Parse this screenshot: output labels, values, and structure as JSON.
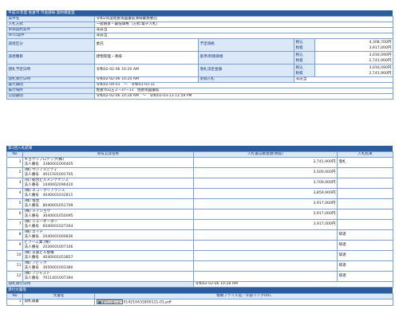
{
  "header1": {
    "title": "平成31年度 佐倉市 市長部局 契約検査室"
  },
  "info": {
    "case_name": {
      "label": "案件名",
      "value": "令和2年度佐倉南図書館清掃業務委託"
    },
    "bid_method": {
      "label": "入札方式",
      "value": "一般競争・最低価格（方式:電子入札）"
    },
    "related_case": {
      "label": "単価契約案件",
      "value": "非該当"
    },
    "wto": {
      "label": "WTO案件",
      "value": "非該当"
    },
    "procurement_type": {
      "label": "調達区分",
      "value": "委託"
    },
    "category": {
      "label": "調達種目",
      "value": "建物管理・清掃"
    },
    "planned_price": {
      "label": "予定価格",
      "tax_incl_label": "税込",
      "tax_incl": "4,308,700円",
      "tax_excl_label": "税抜",
      "tax_excl": "3,917,000円"
    },
    "min_price": {
      "label": "基準/制限価格",
      "tax_incl_label": "税込",
      "tax_incl": "3,016,090円",
      "tax_excl_label": "税抜",
      "tax_excl": "2,741,900円"
    },
    "open_scheduled": {
      "label": "開札予定日時",
      "value": "令和02-02-06 10:20 AM"
    },
    "award_amount": {
      "label": "落札決定金額",
      "tax_incl_label": "税込",
      "tax_incl": "3,016,090円",
      "tax_excl_label": "税抜",
      "tax_excl": "2,741,900円"
    },
    "open_executed": {
      "label": "開札執行日時",
      "value": "令和02-02-06 10:20 AM"
    },
    "single_bid": {
      "label": "単価入札",
      "value": "非該当"
    },
    "period": {
      "label": "履行期間",
      "value": "令和02-04-01　～　令和03-03-31"
    },
    "location": {
      "label": "履行場所",
      "value": "佐倉市山王２−37−13　佐倉南図書館"
    },
    "public_period": {
      "label": "公開期間",
      "value": "令和02-02-06 10:28 AM　～　令和02-03-13 11:59 PM"
    }
  },
  "bids": {
    "title": "第1回入札結果",
    "col_no": "No",
    "col_name": "商号又は名称",
    "col_amount": "入札書記載金額(税抜)",
    "col_result": "入札結果",
    "rows": [
      {
        "no": "1",
        "company": "キョウワプロテック(株)",
        "reg": "法人番号　3380001000405",
        "amount": "2,741,900円",
        "result": "落札"
      },
      {
        "no": "2",
        "company": "(株) サンアメニティ",
        "reg": "法人番号　4011501001705",
        "amount": "3,500,000円",
        "result": ""
      },
      {
        "no": "3",
        "company": "(有) 総合ビルメンテナンス",
        "reg": "法人番号　1040002096420",
        "amount": "3,700,000円",
        "result": ""
      },
      {
        "no": "4",
        "company": "(株) エコ・クリアランス",
        "reg": "法人番号　4040001032811",
        "amount": "3,859,900円",
        "result": ""
      },
      {
        "no": "5",
        "company": "(株) 佐生",
        "reg": "法人番号　8040001051709",
        "amount": "3,917,000円",
        "result": ""
      },
      {
        "no": "6",
        "company": "(株) メイショウ",
        "reg": "法人番号　3040001050095",
        "amount": "3,917,000円",
        "result": ""
      },
      {
        "no": "7",
        "company": "(株) ニューオーダー",
        "reg": "法人番号　6040001027264",
        "amount": "3,917,000円",
        "result": ""
      },
      {
        "no": "8",
        "company": "(株) エイド",
        "reg": "法人番号　2040001000836",
        "amount": "",
        "result": "辞退"
      },
      {
        "no": "9",
        "company": "ビソー工業 (株)",
        "reg": "法人番号　2030001007106",
        "amount": "",
        "result": "辞退"
      },
      {
        "no": "10",
        "company": "(株) 京葉ビル整備",
        "reg": "法人番号　4040001053857",
        "amount": "",
        "result": "辞退"
      },
      {
        "no": "11",
        "company": "(株) アビック",
        "reg": "法人番号　3050001003380",
        "amount": "",
        "result": "辞退"
      },
      {
        "no": "12",
        "company": "(株) アジャスト",
        "reg": "法人番号　7011401007394",
        "amount": "",
        "result": "辞退"
      }
    ],
    "open_executed_label": "開札執行日時",
    "open_executed_value": "令和02-02-06 10:28 AM"
  },
  "docs": {
    "title": "添付文書等",
    "col_no": "No",
    "col_name": "文書名",
    "col_file": "格納ファイル名／外部リンクURL",
    "rows": [
      {
        "no": "1",
        "name": "開札調書",
        "button": "ダウンロード",
        "file": "014210431800111-01.pdf"
      }
    ]
  }
}
